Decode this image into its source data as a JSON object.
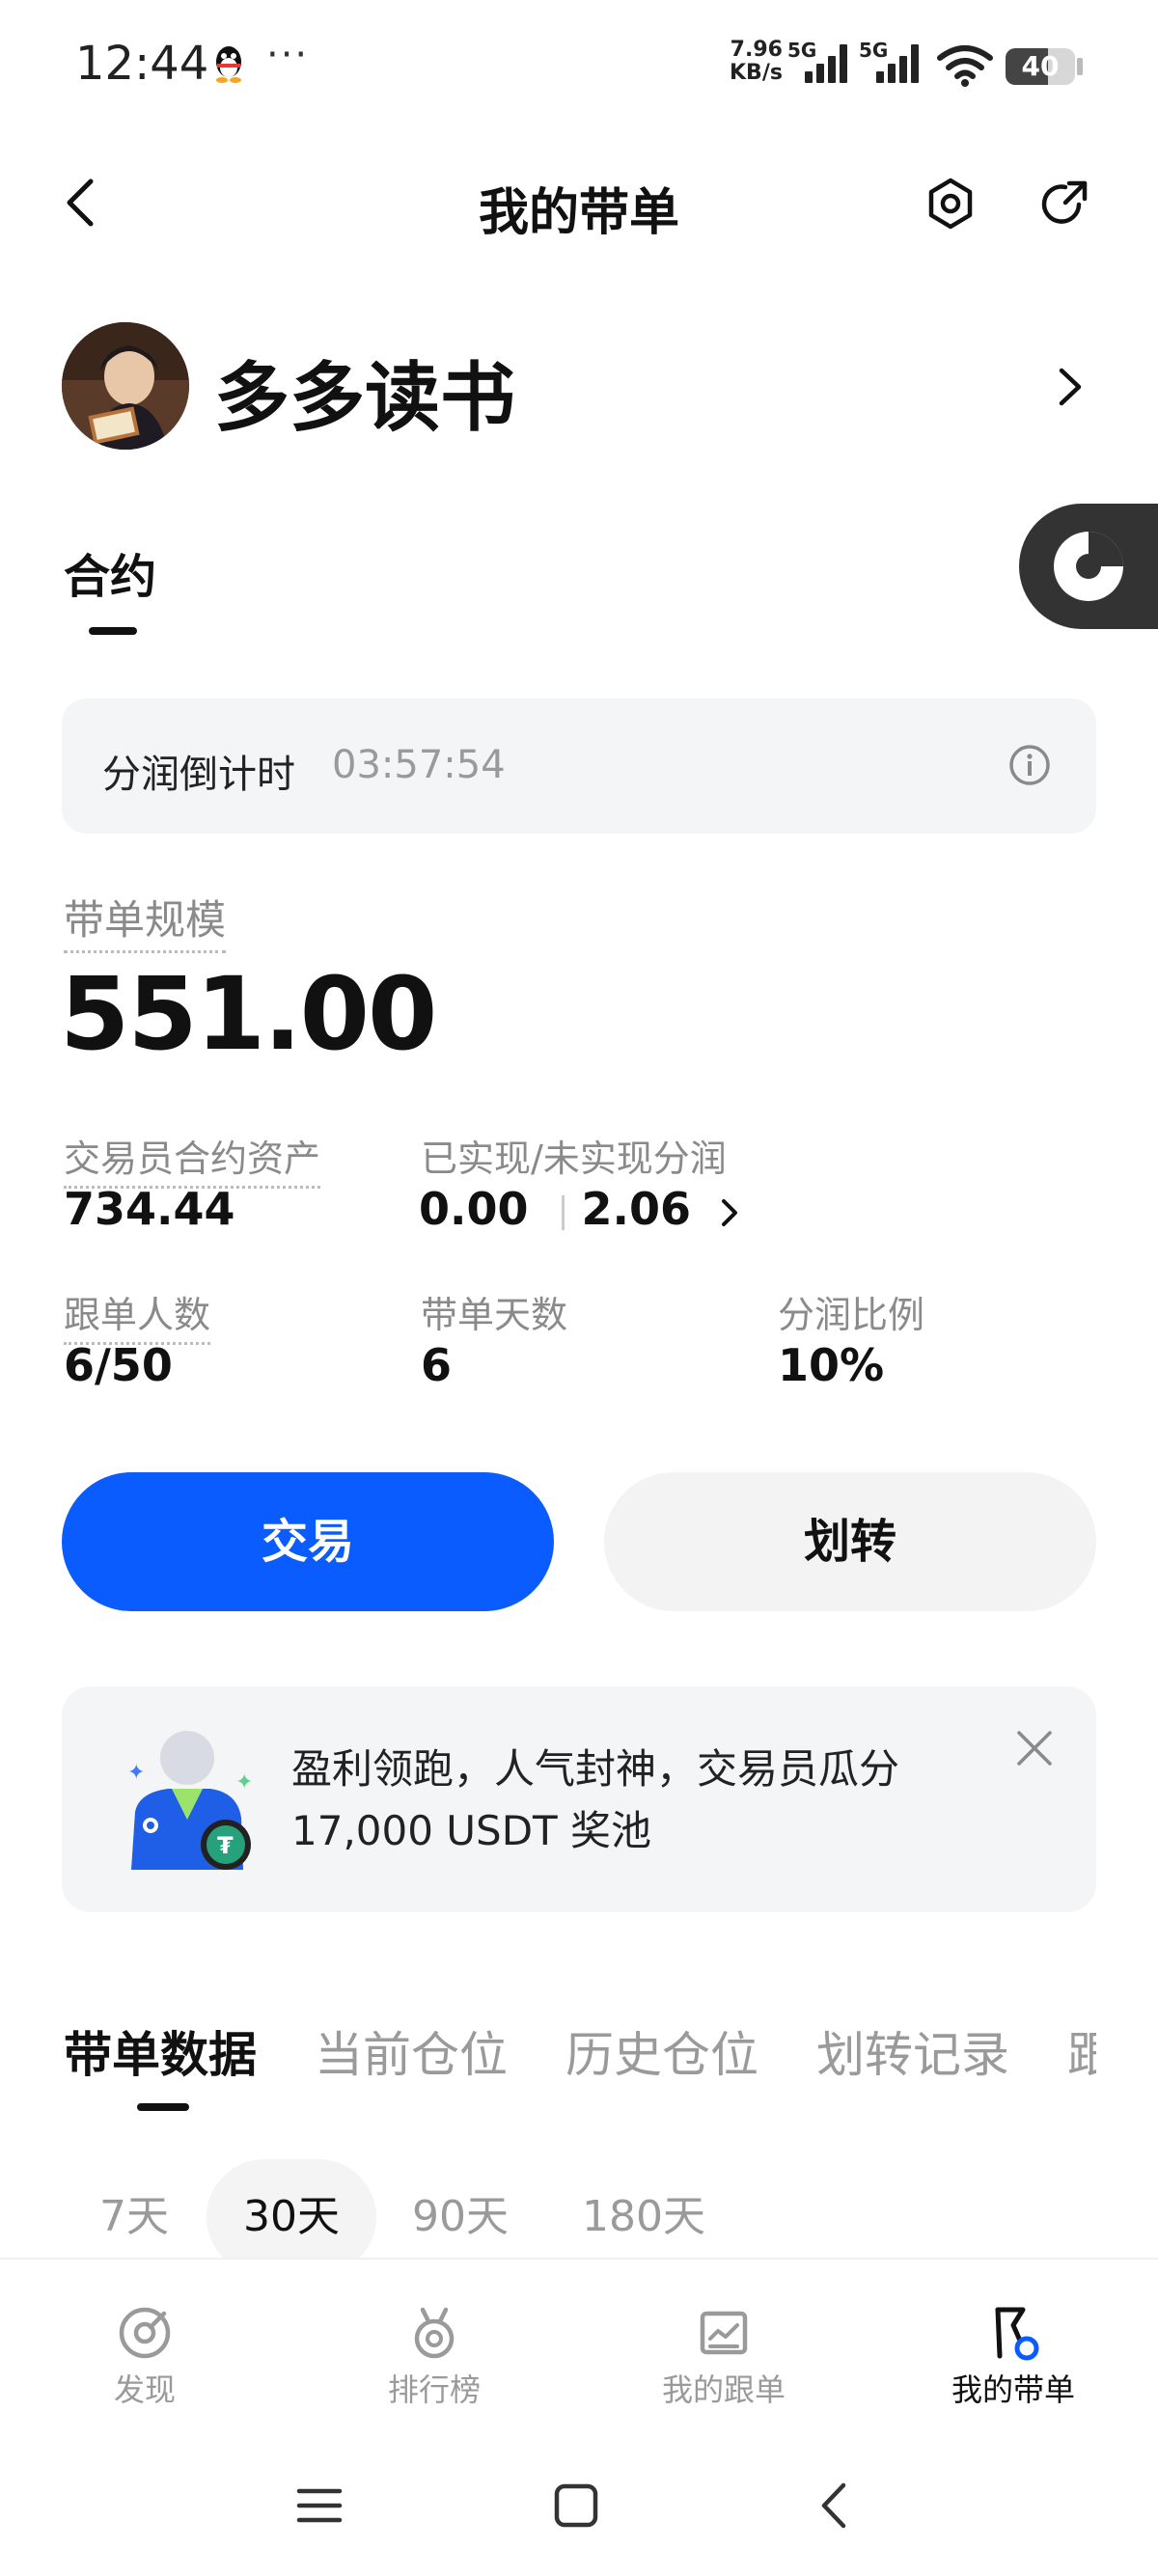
{
  "status_bar": {
    "time": "12:44",
    "dots": "···",
    "speed_value": "7.96",
    "speed_unit": "KB/s",
    "sim1": "5G",
    "sim2": "5G",
    "battery": "40"
  },
  "header": {
    "title": "我的带单",
    "icons": [
      "back-icon",
      "settings-icon",
      "share-icon"
    ]
  },
  "profile": {
    "nickname": "多多读书"
  },
  "contract_tab": "合约",
  "countdown": {
    "label": "分润倒计时",
    "time": "03:57:54"
  },
  "scale": {
    "label": "带单规模",
    "value": "551.00"
  },
  "stats": {
    "assets_label": "交易员合约资产",
    "assets_value": "734.44",
    "profit_label": "已实现/未实现分润",
    "realized": "0.00",
    "unrealized": "2.06",
    "followers_label": "跟单人数",
    "followers_value": "6/50",
    "days_label": "带单天数",
    "days_value": "6",
    "ratio_label": "分润比例",
    "ratio_value": "10%"
  },
  "actions": {
    "trade": "交易",
    "transfer": "划转"
  },
  "promo": {
    "line1": "盈利领跑，人气封神，交易员瓜分",
    "line2": "17,000 USDT 奖池"
  },
  "data_tabs": [
    "带单数据",
    "当前仓位",
    "历史仓位",
    "划转记录",
    "跟"
  ],
  "periods": [
    "7天",
    "30天",
    "90天",
    "180天"
  ],
  "periods_selected": "30天",
  "bottom_nav": [
    "发现",
    "排行榜",
    "我的跟单",
    "我的带单"
  ],
  "bottom_nav_selected": "我的带单",
  "colors": {
    "primary": "#0a5cff",
    "panel": "#f4f5f7",
    "muted_text": "#8a8a8a"
  }
}
